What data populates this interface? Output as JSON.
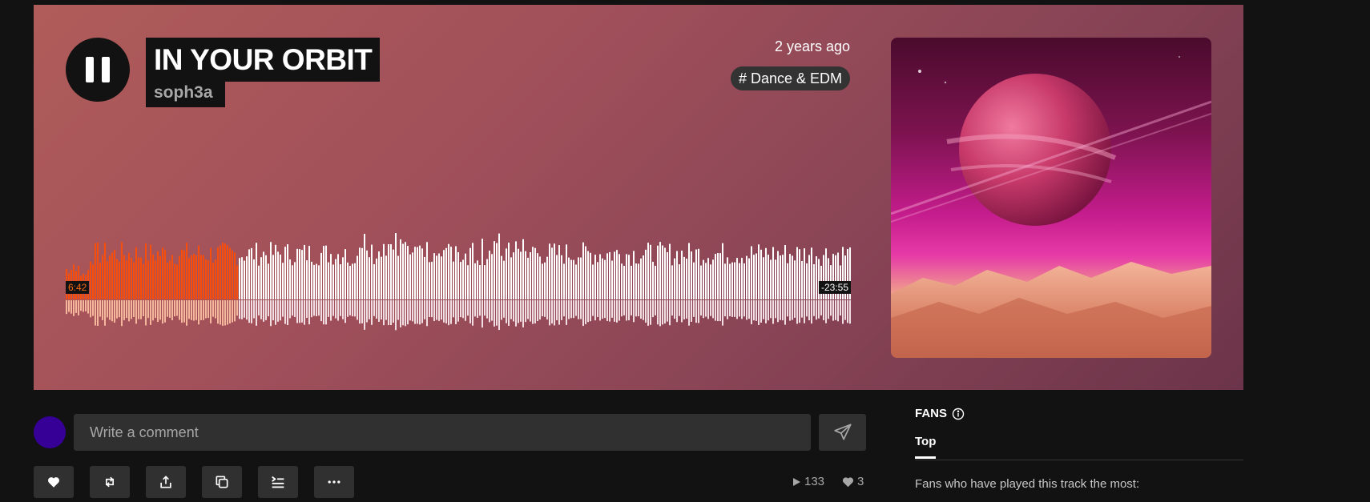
{
  "track": {
    "title": "IN YOUR ORBIT",
    "artist": "soph3a",
    "posted": "2 years ago",
    "tag": "# Dance & EDM",
    "playing": true
  },
  "waveform": {
    "current_time": "6:42",
    "remaining_time": "-23:55",
    "progress": 0.22,
    "played_color": "#f94d0c",
    "unplayed_color": "#ffffff"
  },
  "comment": {
    "placeholder": "Write a comment"
  },
  "actions": [
    "like-icon",
    "repost-icon",
    "share-icon",
    "copy-link-icon",
    "add-to-queue-icon",
    "more-icon"
  ],
  "stats": {
    "plays": "133",
    "likes": "3"
  },
  "fans": {
    "heading": "FANS",
    "tab": "Top",
    "description": "Fans who have played this track the most:"
  },
  "colors": {
    "accent": "#f96a14",
    "avatar": "#360097",
    "background": "#121212"
  }
}
